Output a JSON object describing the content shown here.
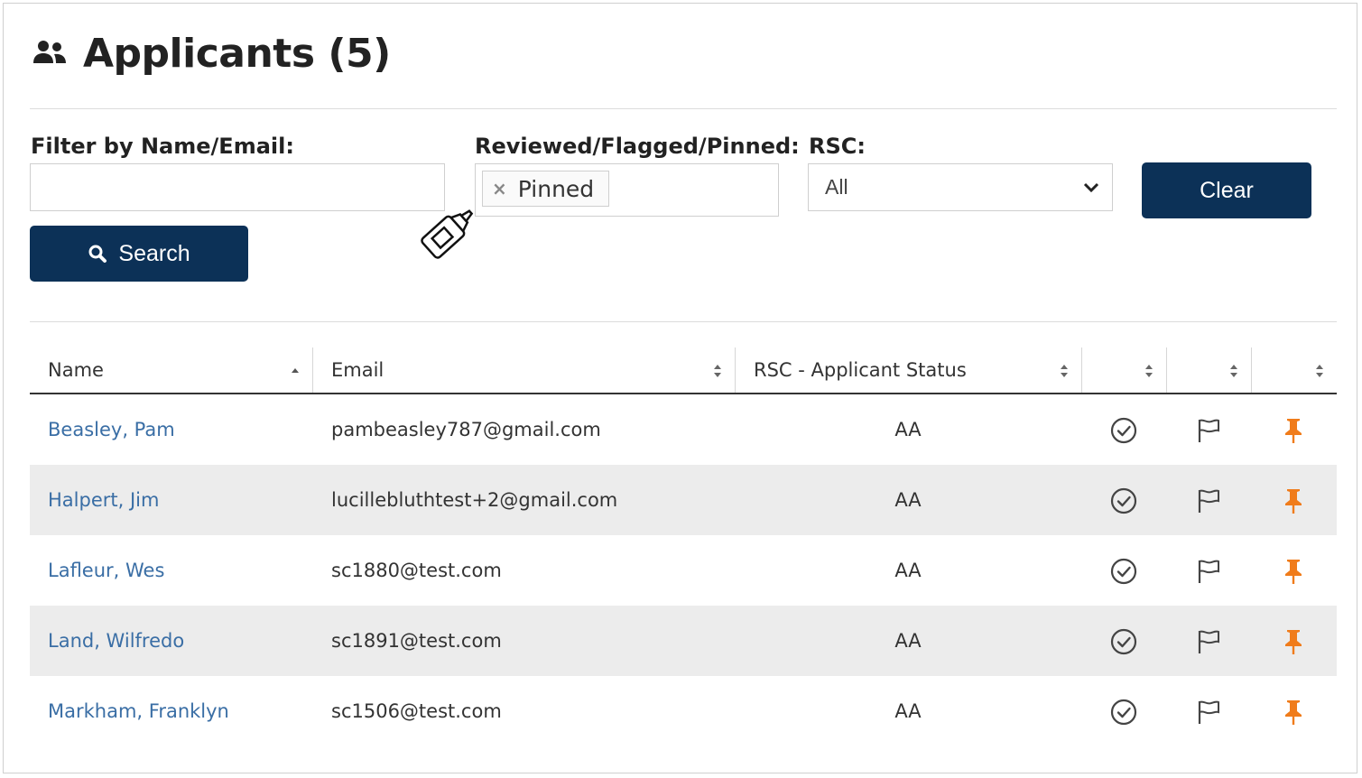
{
  "page": {
    "title": "Applicants (5)",
    "title_icon": "people-icon"
  },
  "filters": {
    "name_email_label": "Filter by Name/Email:",
    "name_email_value": "",
    "name_email_placeholder": "",
    "rfp_label": "Reviewed/Flagged/Pinned:",
    "rfp_chip_remove": "×",
    "rfp_chip_label": "Pinned",
    "rsc_label": "RSC:",
    "rsc_selected": "All",
    "clear_label": "Clear",
    "search_label": "Search"
  },
  "table": {
    "columns": [
      "Name",
      "Email",
      "RSC - Applicant Status",
      "",
      "",
      ""
    ],
    "rows": [
      {
        "name": "Beasley, Pam",
        "email": "pambeasley787@gmail.com",
        "status": "AA"
      },
      {
        "name": "Halpert, Jim",
        "email": "lucillebluthtest+2@gmail.com",
        "status": "AA"
      },
      {
        "name": "Lafleur, Wes",
        "email": "sc1880@test.com",
        "status": "AA"
      },
      {
        "name": "Land, Wilfredo",
        "email": "sc1891@test.com",
        "status": "AA"
      },
      {
        "name": "Markham, Franklyn",
        "email": "sc1506@test.com",
        "status": "AA"
      }
    ]
  },
  "colors": {
    "button_bg": "#0c3157",
    "link": "#3a6ea5",
    "pin": "#f07c1b",
    "alt_row": "#ececec"
  }
}
